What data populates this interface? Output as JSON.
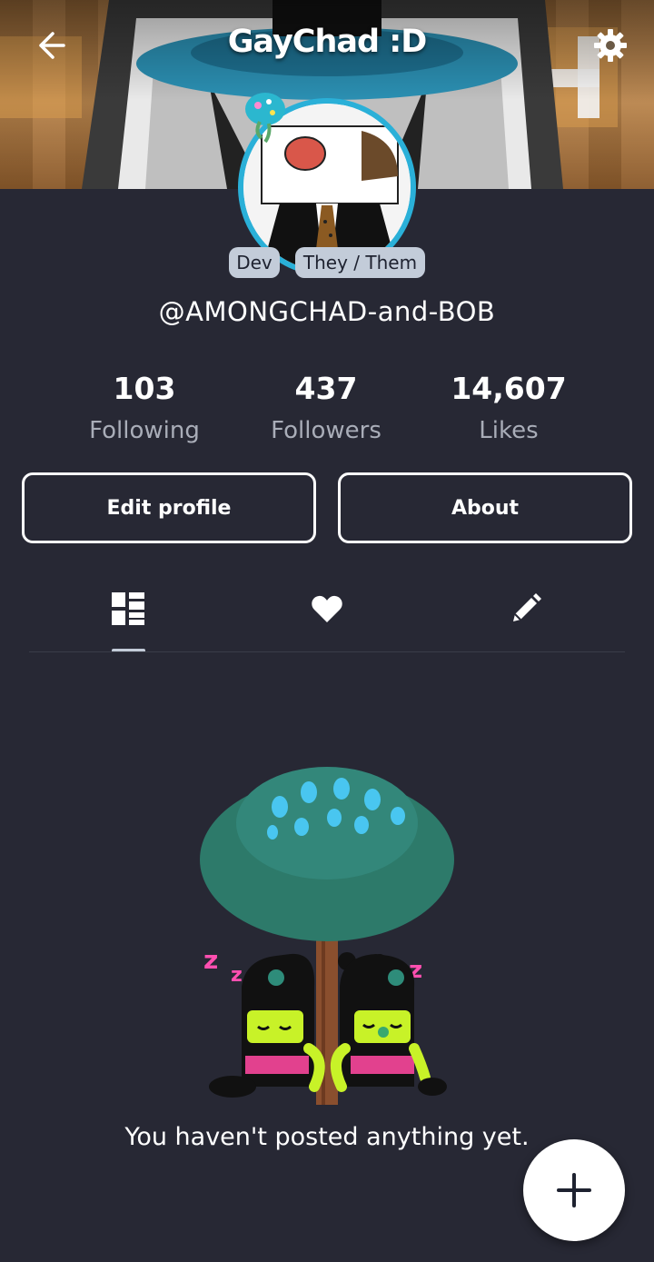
{
  "header": {
    "title": "GayChad :D",
    "back_icon": "arrow-left-icon",
    "settings_icon": "gear-icon"
  },
  "profile": {
    "badges": [
      "Dev",
      "They / Them"
    ],
    "username": "@AMONGCHAD-and-BOB"
  },
  "stats": [
    {
      "value": "103",
      "label": "Following"
    },
    {
      "value": "437",
      "label": "Followers"
    },
    {
      "value": "14,607",
      "label": "Likes"
    }
  ],
  "actions": {
    "edit_label": "Edit profile",
    "about_label": "About"
  },
  "tabs": [
    {
      "icon": "posts-grid-icon",
      "active": true
    },
    {
      "icon": "heart-icon",
      "active": false
    },
    {
      "icon": "pencil-icon",
      "active": false
    }
  ],
  "empty_state": {
    "message": "You haven't posted anything yet."
  },
  "fab": {
    "icon": "plus-icon"
  },
  "colors": {
    "background": "#272834",
    "badge": "#c3ccd9",
    "muted_text": "#a9adb8",
    "avatar_ring": "#2ab0d8"
  }
}
